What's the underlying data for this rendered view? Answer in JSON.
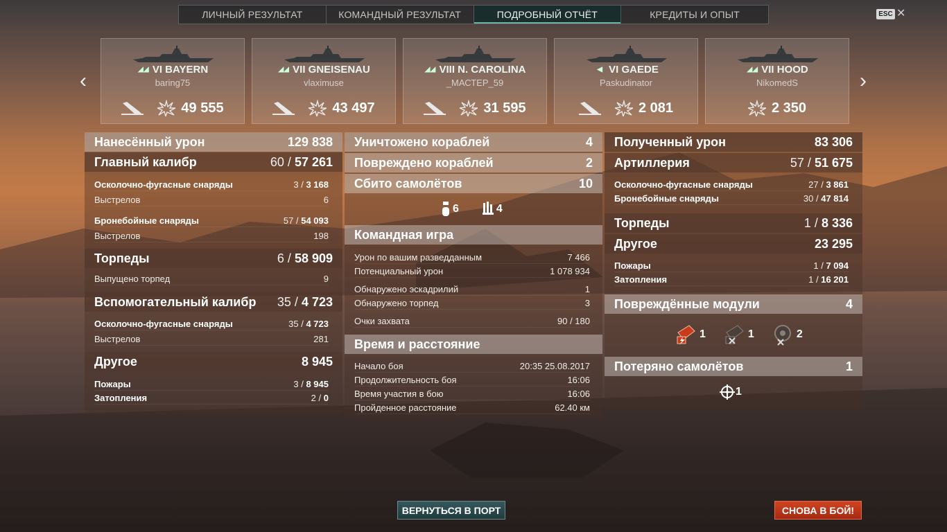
{
  "tabs": [
    "Личный результат",
    "Командный результат",
    "Подробный отчёт",
    "Кредиты и опыт"
  ],
  "active_tab": 2,
  "esc_label": "ESC",
  "ships": [
    {
      "tier_name": "VI BAYERN",
      "player": "baring75",
      "damage": "49 555"
    },
    {
      "tier_name": "VII GNEISENAU",
      "player": "vlaximuse",
      "damage": "43 497"
    },
    {
      "tier_name": "VIII N. CAROLINA",
      "player": "_МАСТЕР_59",
      "damage": "31 595"
    },
    {
      "tier_name": "VI GAEDE",
      "player": "Paskudinator",
      "damage": "2 081"
    },
    {
      "tier_name": "VII HOOD",
      "player": "NikomedS",
      "damage": "2 350"
    }
  ],
  "left": {
    "damage": {
      "label": "Нанесённый урон",
      "value": "129 838"
    },
    "main": {
      "label": "Главный калибр",
      "hits": "60 /",
      "dmg": "57 261"
    },
    "main_rows": [
      {
        "label": "Осколочно-фугасные снаряды",
        "hits": "3 /",
        "dmg": "3 168"
      },
      {
        "label": "Выстрелов",
        "value": "6"
      },
      {
        "label": "Бронебойные снаряды",
        "hits": "57 /",
        "dmg": "54 093"
      },
      {
        "label": "Выстрелов",
        "value": "198"
      }
    ],
    "torp": {
      "label": "Торпеды",
      "hits": "6 /",
      "dmg": "58 909"
    },
    "torp_rows": [
      {
        "label": "Выпущено торпед",
        "value": "9"
      }
    ],
    "sec": {
      "label": "Вспомогательный калибр",
      "hits": "35 /",
      "dmg": "4 723"
    },
    "sec_rows": [
      {
        "label": "Осколочно-фугасные снаряды",
        "hits": "35 /",
        "dmg": "4 723"
      },
      {
        "label": "Выстрелов",
        "value": "281"
      }
    ],
    "other": {
      "label": "Другое",
      "value": "8 945"
    },
    "other_rows": [
      {
        "label": "Пожары",
        "hits": "3 /",
        "dmg": "8 945"
      },
      {
        "label": "Затопления",
        "hits": "2 /",
        "dmg": "0"
      }
    ]
  },
  "mid": {
    "destroyed": {
      "label": "Уничтожено кораблей",
      "value": "4"
    },
    "damaged": {
      "label": "Повреждено кораблей",
      "value": "2"
    },
    "planes": {
      "label": "Сбито самолётов",
      "value": "10"
    },
    "plane_icons": [
      {
        "count": "6"
      },
      {
        "count": "4"
      }
    ],
    "team": {
      "label": "Командная игра"
    },
    "team_rows": [
      {
        "label": "Урон по вашим разведданным",
        "value": "7 466"
      },
      {
        "label": "Потенциальный урон",
        "value": "1 078 934"
      },
      {
        "label": "Обнаружено эскадрилий",
        "value": "1"
      },
      {
        "label": "Обнаружено торпед",
        "value": "3"
      },
      {
        "label": "Очки захвата",
        "value": "90 / 180"
      }
    ],
    "time": {
      "label": "Время и расстояние"
    },
    "time_rows": [
      {
        "label": "Начало боя",
        "value": "20:35  25.08.2017"
      },
      {
        "label": "Продолжительность боя",
        "value": "16:06"
      },
      {
        "label": "Время участия в бою",
        "value": "16:06"
      },
      {
        "label": "Пройденное расстояние",
        "value": "62.40 км"
      }
    ]
  },
  "right": {
    "received": {
      "label": "Полученный урон",
      "value": "83 306"
    },
    "art": {
      "label": "Артиллерия",
      "hits": "57 /",
      "dmg": "51 675"
    },
    "art_rows": [
      {
        "label": "Осколочно-фугасные снаряды",
        "hits": "27 /",
        "dmg": "3 861"
      },
      {
        "label": "Бронебойные снаряды",
        "hits": "30 /",
        "dmg": "47 814"
      }
    ],
    "torp": {
      "label": "Торпеды",
      "hits": "1 /",
      "dmg": "8 336"
    },
    "other": {
      "label": "Другое",
      "value": "23 295"
    },
    "other_rows": [
      {
        "label": "Пожары",
        "hits": "1 /",
        "dmg": "7 094"
      },
      {
        "label": "Затопления",
        "hits": "1 /",
        "dmg": "16 201"
      }
    ],
    "modules": {
      "label": "Повреждённые модули",
      "value": "4"
    },
    "module_icons": [
      {
        "count": "1"
      },
      {
        "count": "1"
      },
      {
        "count": "2"
      }
    ],
    "lost": {
      "label": "Потеряно самолётов",
      "value": "1"
    },
    "lost_icons": [
      {
        "count": "1"
      }
    ]
  },
  "buttons": {
    "port": "Вернуться в порт",
    "battle": "Снова в бой!"
  }
}
